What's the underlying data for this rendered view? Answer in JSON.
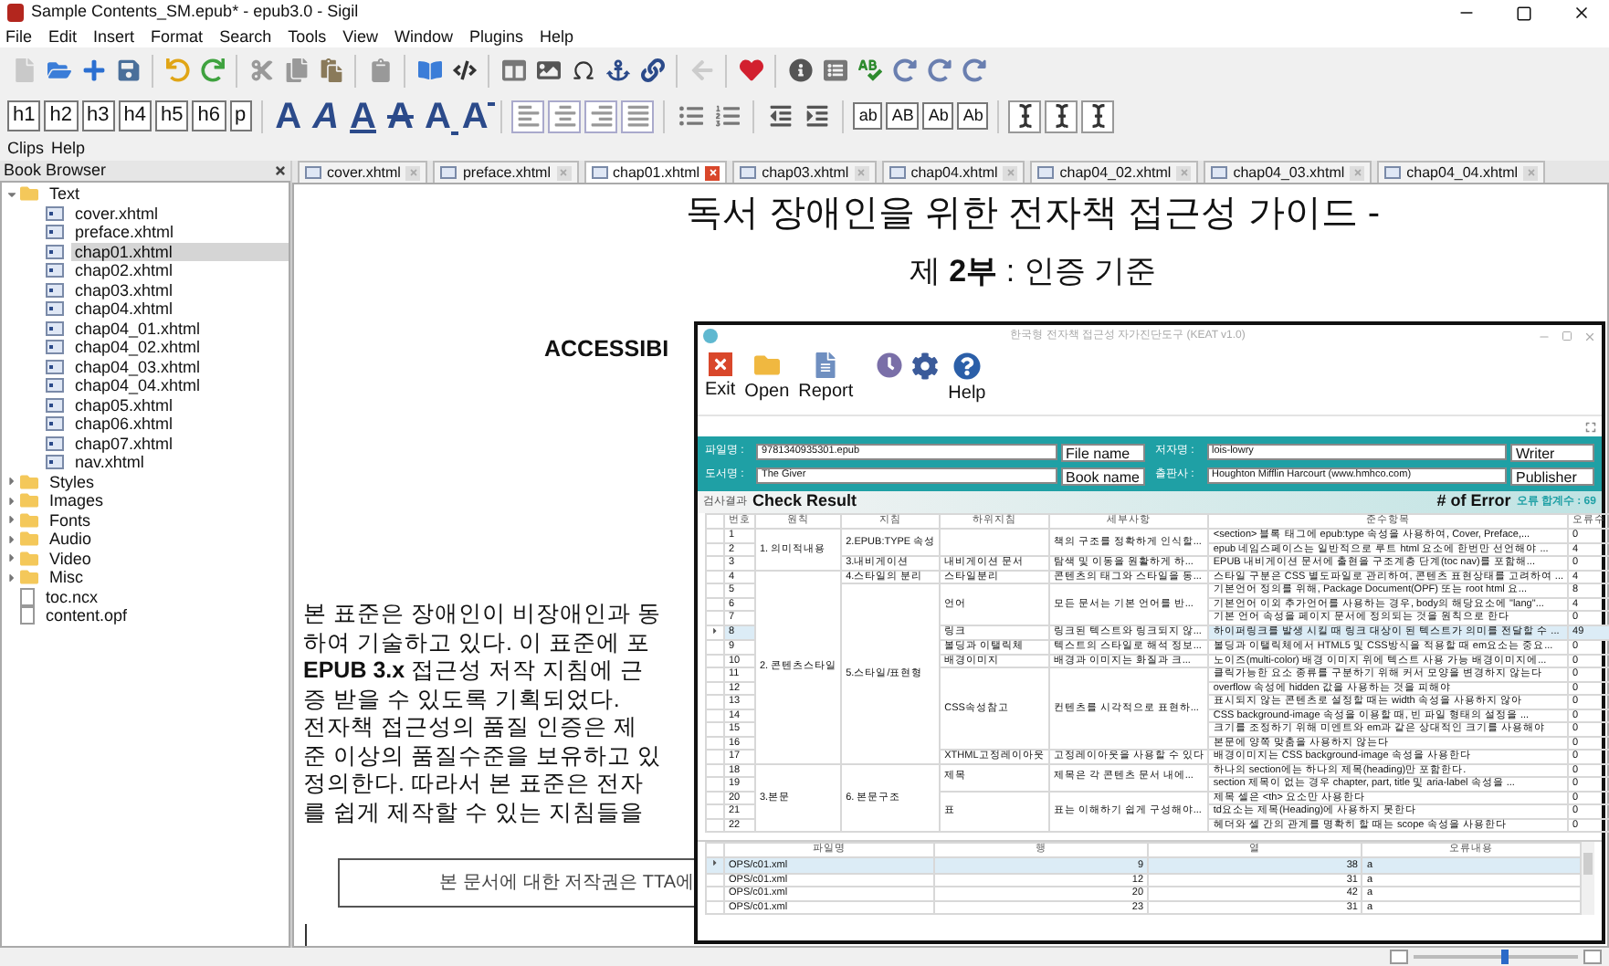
{
  "window": {
    "title": "Sample Contents_SM.epub* - epub3.0 - Sigil"
  },
  "menu": [
    "File",
    "Edit",
    "Insert",
    "Format",
    "Search",
    "Tools",
    "View",
    "Window",
    "Plugins",
    "Help"
  ],
  "heading_buttons": [
    "h1",
    "h2",
    "h3",
    "h4",
    "h5",
    "h6",
    "p"
  ],
  "style_buttons": [
    {
      "label": "A",
      "kind": "bold"
    },
    {
      "label": "A",
      "kind": "italic"
    },
    {
      "label": "A",
      "kind": "underline"
    },
    {
      "label": "A",
      "kind": "strike"
    },
    {
      "label": "A",
      "kind": "sub"
    },
    {
      "label": "A",
      "kind": "sup"
    }
  ],
  "case_buttons": [
    "ab",
    "AB",
    "Ab",
    "Ab"
  ],
  "clips_menu": [
    "Clips",
    "Help"
  ],
  "book_browser": {
    "title": "Book Browser",
    "items": [
      {
        "label": "Text",
        "kind": "folder",
        "expanded": true,
        "selected": false,
        "children": [
          {
            "label": "cover.xhtml",
            "kind": "file",
            "selected": false
          },
          {
            "label": "preface.xhtml",
            "kind": "file",
            "selected": false
          },
          {
            "label": "chap01.xhtml",
            "kind": "file",
            "selected": true
          },
          {
            "label": "chap02.xhtml",
            "kind": "file",
            "selected": false
          },
          {
            "label": "chap03.xhtml",
            "kind": "file",
            "selected": false
          },
          {
            "label": "chap04.xhtml",
            "kind": "file",
            "selected": false
          },
          {
            "label": "chap04_01.xhtml",
            "kind": "file",
            "selected": false
          },
          {
            "label": "chap04_02.xhtml",
            "kind": "file",
            "selected": false
          },
          {
            "label": "chap04_03.xhtml",
            "kind": "file",
            "selected": false
          },
          {
            "label": "chap04_04.xhtml",
            "kind": "file",
            "selected": false
          },
          {
            "label": "chap05.xhtml",
            "kind": "file",
            "selected": false
          },
          {
            "label": "chap06.xhtml",
            "kind": "file",
            "selected": false
          },
          {
            "label": "chap07.xhtml",
            "kind": "file",
            "selected": false
          },
          {
            "label": "nav.xhtml",
            "kind": "file",
            "selected": false
          }
        ]
      },
      {
        "label": "Styles",
        "kind": "folder",
        "expanded": false,
        "selected": false
      },
      {
        "label": "Images",
        "kind": "folder",
        "expanded": false,
        "selected": false
      },
      {
        "label": "Fonts",
        "kind": "folder",
        "expanded": false,
        "selected": false
      },
      {
        "label": "Audio",
        "kind": "folder",
        "expanded": false,
        "selected": false
      },
      {
        "label": "Video",
        "kind": "folder",
        "expanded": false,
        "selected": false
      },
      {
        "label": "Misc",
        "kind": "folder",
        "expanded": false,
        "selected": false
      },
      {
        "label": "toc.ncx",
        "kind": "doc",
        "selected": false
      },
      {
        "label": "content.opf",
        "kind": "doc",
        "selected": false
      }
    ]
  },
  "tabs": [
    {
      "label": "cover.xhtml",
      "selected": false
    },
    {
      "label": "preface.xhtml",
      "selected": false
    },
    {
      "label": "chap01.xhtml",
      "selected": true
    },
    {
      "label": "chap03.xhtml",
      "selected": false
    },
    {
      "label": "chap04.xhtml",
      "selected": false
    },
    {
      "label": "chap04_02.xhtml",
      "selected": false
    },
    {
      "label": "chap04_03.xhtml",
      "selected": false
    },
    {
      "label": "chap04_04.xhtml",
      "selected": false
    }
  ],
  "document": {
    "title": "독서 장애인을 위한 전자책 접근성 가이드 -",
    "subtitle": "제 **2부** : 인증 기준",
    "section_heading": "ACCESSIBI",
    "paragraph_lines": [
      "본 표준은 장애인이 비장애인과 동",
      "하여 기술하고 있다. 이 표준에 포",
      "**EPUB 3.x** 접근성 저작 지침에 근",
      "증 받을 수 있도록 기획되었다.",
      "전자책 접근성의 품질 인증은 제",
      "준 이상의 품질수준을 보유하고 있",
      "정의한다. 따라서 본 표준은 전자",
      "를 쉽게 제작할 수 있는 지침들을"
    ],
    "copyright_box": "본 문서에 대한 저작권은 TTA에"
  },
  "status_bar": {
    "zoom": {
      "level": 0.55
    }
  },
  "keat": {
    "title": "한국형 전자책 접근성 자가진단도구 (KEAT v1.0)",
    "toolbar": [
      {
        "label": "Exit",
        "kind": "exit"
      },
      {
        "label": "Open",
        "kind": "open"
      },
      {
        "label": "Report",
        "kind": "report"
      },
      {
        "kind": "history"
      },
      {
        "kind": "settings"
      },
      {
        "label": "Help",
        "kind": "help"
      }
    ],
    "fields": [
      {
        "label": "파일명 :",
        "value": "9781340935301.epub",
        "caption": "File name"
      },
      {
        "label": "저자명 :",
        "value": "lois-lowry",
        "caption": "Writer"
      },
      {
        "label": "도서명 :",
        "value": "The Giver",
        "caption": "Book name"
      },
      {
        "label": "출판사 :",
        "value": "Houghton Mifflin Harcourt (www.hmhco.com)",
        "caption": "Publisher"
      }
    ],
    "result_label": "검사결과",
    "result_title": "Check Result",
    "error_title": "# of Error",
    "error_total": "오류 합계수 : 69",
    "columns": [
      "번호",
      "원칙",
      "지침",
      "하위지침",
      "세부사항",
      "준수항목",
      "오류수"
    ],
    "principles": [
      {
        "name": "1. 의미적내용",
        "guidelines": [
          {
            "name": "2.EPUB:TYPE 속성",
            "subs": [
              {
                "detail": "책의 구조를 정확하게 인식할...",
                "items": [
                  {
                    "no": "1",
                    "text": "<section> 블록 태그에 epub:type 속성을 사용하여, Cover, Preface,...",
                    "errors": "0",
                    "selected": false
                  },
                  {
                    "no": "2",
                    "text": "epub 네임스페이스는 일반적으로 루트 html 요소에 한번만 선언해야 ...",
                    "errors": "4",
                    "selected": false
                  }
                ]
              }
            ]
          },
          {
            "name": "3.내비게이션",
            "subs": [
              {
                "name": "내비게이션 문서",
                "detail": "탐색 및 이동을 원활하게 하...",
                "items": [
                  {
                    "no": "3",
                    "text": "EPUB 내비게이션 문서에 출현을 구조계층 단계(toc nav)를 포함해...",
                    "errors": "0",
                    "selected": false
                  }
                ]
              }
            ]
          }
        ]
      },
      {
        "name": "2. 콘텐츠스타일",
        "guidelines": [
          {
            "name": "4.스타일의 분리",
            "subs": [
              {
                "name": "스타일분리",
                "detail": "콘텐츠의 태그와 스타일을 동...",
                "items": [
                  {
                    "no": "4",
                    "text": "스타일 구분은 CSS 별도파일로 관리하여, 콘텐츠 표현상태를 고려하여 ...",
                    "errors": "4",
                    "selected": false
                  }
                ]
              }
            ]
          },
          {
            "name": "5.스타일/표현형",
            "subs": [
              {
                "name": "언어",
                "detail": "모든 문서는 기본 언어를 반...",
                "items": [
                  {
                    "no": "5",
                    "text": "기본언어 정의를 위해, Package Document(OPF) 또는 root html 요...",
                    "errors": "8",
                    "selected": false
                  },
                  {
                    "no": "6",
                    "text": "기본언어 이외 추가언어를 사용하는 경우, body의 해당요소에 \"lang\"...",
                    "errors": "4",
                    "selected": false
                  },
                  {
                    "no": "7",
                    "text": "기본 언어 속성을 페이지 문서에 정의되는 것을 원칙으로 한다",
                    "errors": "0",
                    "selected": false
                  }
                ]
              },
              {
                "name": "링크",
                "detail": "링크된 텍스트와 링크되지 않...",
                "items": [
                  {
                    "no": "8",
                    "text": "하이퍼링크를 발생 시킬 때 링크 대상이 된 텍스트가 의미를 전달할 수 ...",
                    "errors": "49",
                    "selected": true
                  }
                ]
              },
              {
                "name": "볼딩과 이탤릭체",
                "detail": "텍스트의 스타일로 해석 정보...",
                "items": [
                  {
                    "no": "9",
                    "text": "볼딩과 이탤릭체에서 HTML5 및 CSS방식을 적용할 때 em요소는 중요...",
                    "errors": "0",
                    "selected": false
                  }
                ]
              },
              {
                "name": "배경이미지",
                "detail": "배경과 이미지는 화질과 크...",
                "items": [
                  {
                    "no": "10",
                    "text": "노이즈(multi-color) 배경 이미지 위에 텍스트 사용 가능 배경이미지에...",
                    "errors": "0",
                    "selected": false
                  }
                ]
              },
              {
                "name": "CSS속성참고",
                "detail": "컨텐츠를 시각적으로 표현하...",
                "items": [
                  {
                    "no": "11",
                    "text": "클릭가능한 요소 종류를 구분하기 위해 커서 모양을 변경하지 않는다",
                    "errors": "0",
                    "selected": false
                  },
                  {
                    "no": "12",
                    "text": "overflow 속성에 hidden 값을 사용하는 것을 피해야",
                    "errors": "0",
                    "selected": false
                  },
                  {
                    "no": "13",
                    "text": "표시되지 않는 콘텐츠로 설정할 때는 width 속성을 사용하지 않아",
                    "errors": "0",
                    "selected": false
                  },
                  {
                    "no": "14",
                    "text": "CSS background-image 속성을 이용할 때, 빈 파일 형태의 설정을 ...",
                    "errors": "0",
                    "selected": false
                  },
                  {
                    "no": "15",
                    "text": "크기를 조정하기 위해 미엔트와 em과 같은 상대적인 크기를 사용해야",
                    "errors": "0",
                    "selected": false
                  },
                  {
                    "no": "16",
                    "text": "본문에 양쪽 맞춤을 사용하지 않는다",
                    "errors": "0",
                    "selected": false
                  }
                ]
              },
              {
                "name": "XTHML고정레이아웃",
                "detail": "고정레이아웃을 사용할 수 있다",
                "items": [
                  {
                    "no": "17",
                    "text": "배경이미지는 CSS background-image 속성을 사용한다",
                    "errors": "0",
                    "selected": false
                  }
                ]
              }
            ]
          }
        ]
      },
      {
        "name": "3.본문",
        "guidelines": [
          {
            "name": "6. 본문구조",
            "subs": [
              {
                "name": "제목",
                "detail": "제목은 각 콘텐츠 문서 내에...",
                "items": [
                  {
                    "no": "18",
                    "text": "하나의 section에는 하나의 제목(heading)만 포함한다.",
                    "errors": "0",
                    "selected": false
                  },
                  {
                    "no": "19",
                    "text": "section 제목이 없는 경우 chapter, part, title 및 aria-label 속성을 ...",
                    "errors": "0",
                    "selected": false
                  }
                ]
              },
              {
                "name": "표",
                "detail": "표는 이해하기 쉽게 구성해야...",
                "items": [
                  {
                    "no": "20",
                    "text": "제목 셀은 <th> 요소만 사용한다",
                    "errors": "0",
                    "selected": false
                  },
                  {
                    "no": "21",
                    "text": "td요소는 제목(Heading)에 사용하지 못한다",
                    "errors": "0",
                    "selected": false
                  },
                  {
                    "no": "22",
                    "text": "헤더와 셀 간의 관계를 명확히 할 때는 scope 속성을 사용한다",
                    "errors": "0",
                    "selected": false
                  }
                ]
              }
            ]
          }
        ]
      }
    ],
    "detail_columns": [
      "파일명",
      "행",
      "열",
      "오류내용"
    ],
    "detail_rows": [
      {
        "cells": [
          "OPS/c01.xml",
          "9",
          "38",
          "a"
        ],
        "selected": true
      },
      {
        "cells": [
          "OPS/c01.xml",
          "12",
          "31",
          "a"
        ],
        "selected": false
      },
      {
        "cells": [
          "OPS/c01.xml",
          "20",
          "42",
          "a"
        ],
        "selected": false
      },
      {
        "cells": [
          "OPS/c01.xml",
          "23",
          "31",
          "a"
        ],
        "selected": false
      }
    ]
  }
}
